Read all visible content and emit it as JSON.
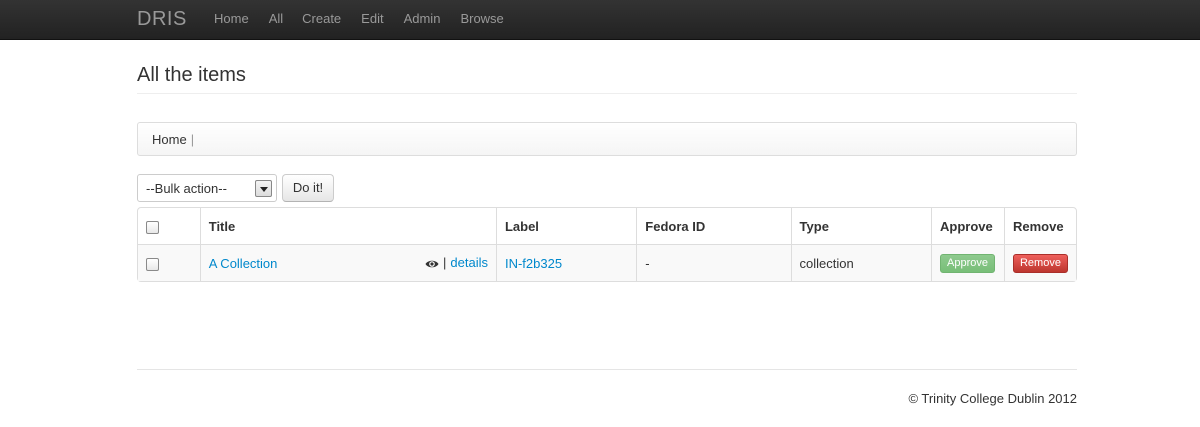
{
  "navbar": {
    "brand": "DRIS",
    "items": [
      "Home",
      "All",
      "Create",
      "Edit",
      "Admin",
      "Browse"
    ]
  },
  "page": {
    "title": "All the items"
  },
  "breadcrumb": {
    "items": [
      "Home"
    ],
    "divider": "|"
  },
  "bulk": {
    "selected": "--Bulk action--",
    "button_label": "Do it!"
  },
  "table": {
    "headers": [
      "",
      "Title",
      "Label",
      "Fedora ID",
      "Type",
      "Approve",
      "Remove"
    ],
    "rows": [
      {
        "title": "A Collection",
        "details_label": "details",
        "separator": "|",
        "label": "IN-f2b325",
        "fedora_id": "-",
        "type": "collection",
        "approve_label": "Approve",
        "remove_label": "Remove"
      }
    ]
  },
  "footer": {
    "text": "© Trinity College Dublin 2012"
  },
  "colors": {
    "navbar_bg": "#222222",
    "link": "#0088cc",
    "approve": "#62b562",
    "remove": "#da4f49"
  }
}
